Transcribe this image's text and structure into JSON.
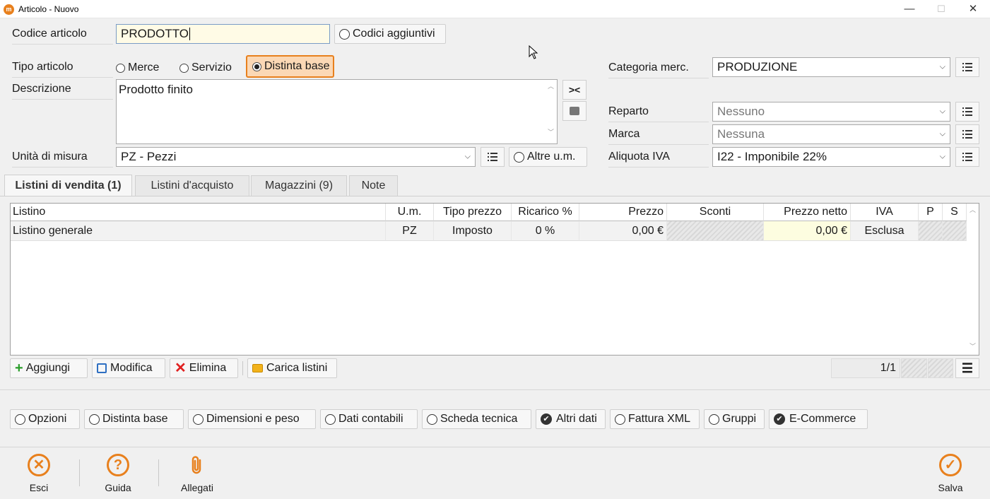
{
  "window": {
    "title": "Articolo - Nuovo",
    "minimize": "—",
    "maximize": "☐",
    "close": "✕"
  },
  "form": {
    "codice_label": "Codice articolo",
    "codice_value": "PRODOTTO",
    "codici_aggiuntivi": "Codici aggiuntivi",
    "tipo_label": "Tipo articolo",
    "tipo_options": [
      "Merce",
      "Servizio",
      "Distinta base"
    ],
    "tipo_selected": "Distinta base",
    "descrizione_label": "Descrizione",
    "descrizione_value": "Prodotto finito",
    "um_label": "Unità di misura",
    "um_value": "PZ - Pezzi",
    "altre_um": "Altre u.m.",
    "categoria_label": "Categoria merc.",
    "categoria_value": "PRODUZIONE",
    "reparto_label": "Reparto",
    "reparto_value": "Nessuno",
    "marca_label": "Marca",
    "marca_value": "Nessuna",
    "iva_label": "Aliquota IVA",
    "iva_value": "I22 - Imponibile 22%"
  },
  "tabs": [
    {
      "label": "Listini di vendita (1)",
      "active": true
    },
    {
      "label": "Listini d'acquisto",
      "active": false
    },
    {
      "label": "Magazzini (9)",
      "active": false
    },
    {
      "label": "Note",
      "active": false
    }
  ],
  "grid": {
    "columns": [
      "Listino",
      "U.m.",
      "Tipo prezzo",
      "Ricarico %",
      "Prezzo",
      "Sconti",
      "Prezzo netto",
      "IVA",
      "P",
      "S"
    ],
    "rows": [
      {
        "listino": "Listino generale",
        "um": "PZ",
        "tipo": "Imposto",
        "ricarico": "0 %",
        "prezzo": "0,00 €",
        "sconti": "",
        "netto": "0,00 €",
        "iva": "Esclusa",
        "p": "",
        "s": ""
      }
    ]
  },
  "grid_actions": {
    "aggiungi": "Aggiungi",
    "modifica": "Modifica",
    "elimina": "Elimina",
    "carica": "Carica listini",
    "pager": "1/1"
  },
  "options": [
    {
      "label": "Opzioni",
      "checked": false
    },
    {
      "label": "Distinta base",
      "checked": false
    },
    {
      "label": "Dimensioni e peso",
      "checked": false
    },
    {
      "label": "Dati contabili",
      "checked": false
    },
    {
      "label": "Scheda tecnica",
      "checked": false
    },
    {
      "label": "Altri dati",
      "checked": true
    },
    {
      "label": "Fattura XML",
      "checked": false
    },
    {
      "label": "Gruppi",
      "checked": false
    },
    {
      "label": "E-Commerce",
      "checked": true
    }
  ],
  "footer": {
    "esci": "Esci",
    "guida": "Guida",
    "allegati": "Allegati",
    "salva": "Salva"
  },
  "colors": {
    "accent": "#e8801d",
    "selected_bg": "#fbd8b5",
    "net_price_bg": "#fdfde0",
    "code_bg": "#fffbe6"
  }
}
